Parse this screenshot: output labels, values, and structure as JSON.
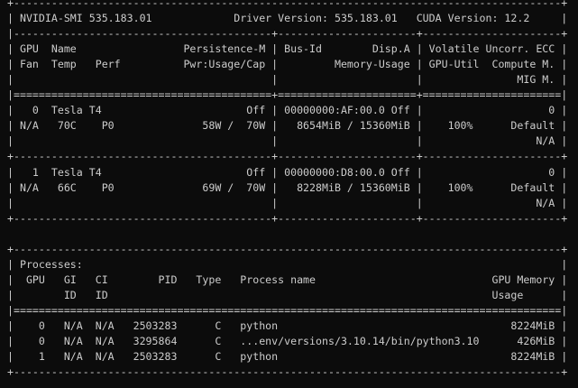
{
  "terminal": {
    "lines": [
      "+---------------------------------------------------------------------------------------+",
      "| NVIDIA-SMI 535.183.01             Driver Version: 535.183.01   CUDA Version: 12.2     |",
      "|-----------------------------------------+----------------------+----------------------+",
      "| GPU  Name                 Persistence-M | Bus-Id        Disp.A | Volatile Uncorr. ECC |",
      "| Fan  Temp   Perf          Pwr:Usage/Cap |         Memory-Usage | GPU-Util  Compute M. |",
      "|                                         |                      |               MIG M. |",
      "|=========================================+======================+======================|",
      "|   0  Tesla T4                       Off | 00000000:AF:00.0 Off |                    0 |",
      "| N/A   70C    P0              58W /  70W |   8654MiB / 15360MiB |    100%      Default |",
      "|                                         |                      |                  N/A |",
      "+-----------------------------------------+----------------------+----------------------+",
      "|   1  Tesla T4                       Off | 00000000:D8:00.0 Off |                    0 |",
      "| N/A   66C    P0              69W /  70W |   8228MiB / 15360MiB |    100%      Default |",
      "|                                         |                      |                  N/A |",
      "+-----------------------------------------+----------------------+----------------------+",
      " ",
      "+---------------------------------------------------------------------------------------+",
      "| Processes:                                                                            |",
      "|  GPU   GI   CI        PID   Type   Process name                            GPU Memory |",
      "|        ID   ID                                                             Usage      |",
      "|=======================================================================================|",
      "|    0   N/A  N/A   2503283      C   python                                     8224MiB |",
      "|    0   N/A  N/A   3295864      C   ...env/versions/3.10.14/bin/python3.10      426MiB |",
      "|    1   N/A  N/A   2503283      C   python                                     8224MiB |",
      "+---------------------------------------------------------------------------------------+"
    ]
  }
}
